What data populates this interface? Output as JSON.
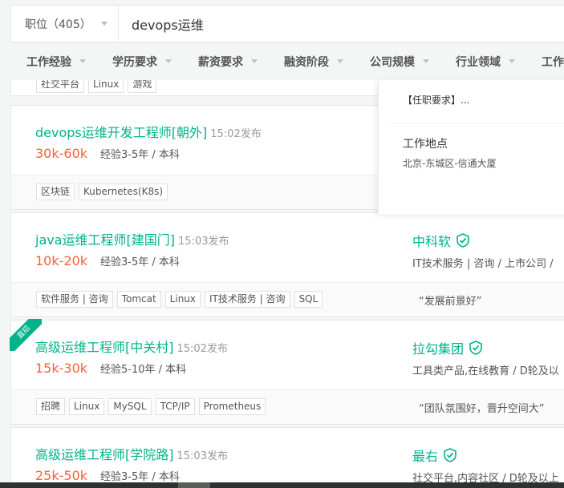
{
  "search": {
    "type_label": "职位（405）",
    "query": "devops运维"
  },
  "filters": [
    "工作经验",
    "学历要求",
    "薪资要求",
    "融资阶段",
    "公司规模",
    "行业领域",
    "工作"
  ],
  "partial_card": {
    "tags": [
      "社交平台",
      "Linux",
      "游戏"
    ]
  },
  "jobs": [
    {
      "title": "devops运维开发工程师[朝外]",
      "time": "15:02发布",
      "salary": "30k-60k",
      "requirement": "经验3-5年 / 本科",
      "company": "",
      "industry": "",
      "tags": [
        "区块链",
        "Kubernetes(K8s)"
      ],
      "welfare": ""
    },
    {
      "title": "java运维工程师[建国门]",
      "time": "15:03发布",
      "salary": "10k-20k",
      "requirement": "经验3-5年 / 本科",
      "company": "中科软",
      "industry": "IT技术服务 | 咨询 / 上市公司 /",
      "tags": [
        "软件服务 | 咨询",
        "Tomcat",
        "Linux",
        "IT技术服务 | 咨询",
        "SQL"
      ],
      "welfare": "“发展前景好”"
    },
    {
      "title": "高级运维工程师[中关村]",
      "time": "15:02发布",
      "salary": "15k-30k",
      "requirement": "经验5-10年 / 本科",
      "company": "拉勾集团",
      "industry": "工具类产品,在线教育 / D轮及以",
      "tags": [
        "招聘",
        "Linux",
        "MySQL",
        "TCP/IP",
        "Prometheus"
      ],
      "welfare": "“团队氛围好，晋升空间大”",
      "badge": "直招"
    },
    {
      "title": "高级运维工程师[学院路]",
      "time": "15:03发布",
      "salary": "25k-50k",
      "requirement": "经验3-5年 / 本科",
      "company": "最右",
      "industry": "社交平台,内容社区 / D轮及以上",
      "tags": [],
      "welfare": ""
    }
  ],
  "popup": {
    "description": "【任职要求】...",
    "location_title": "工作地点",
    "location": "北京-东城区-信通大厦"
  },
  "colors": {
    "accent": "#00b38a",
    "salary": "#fd5f39"
  }
}
